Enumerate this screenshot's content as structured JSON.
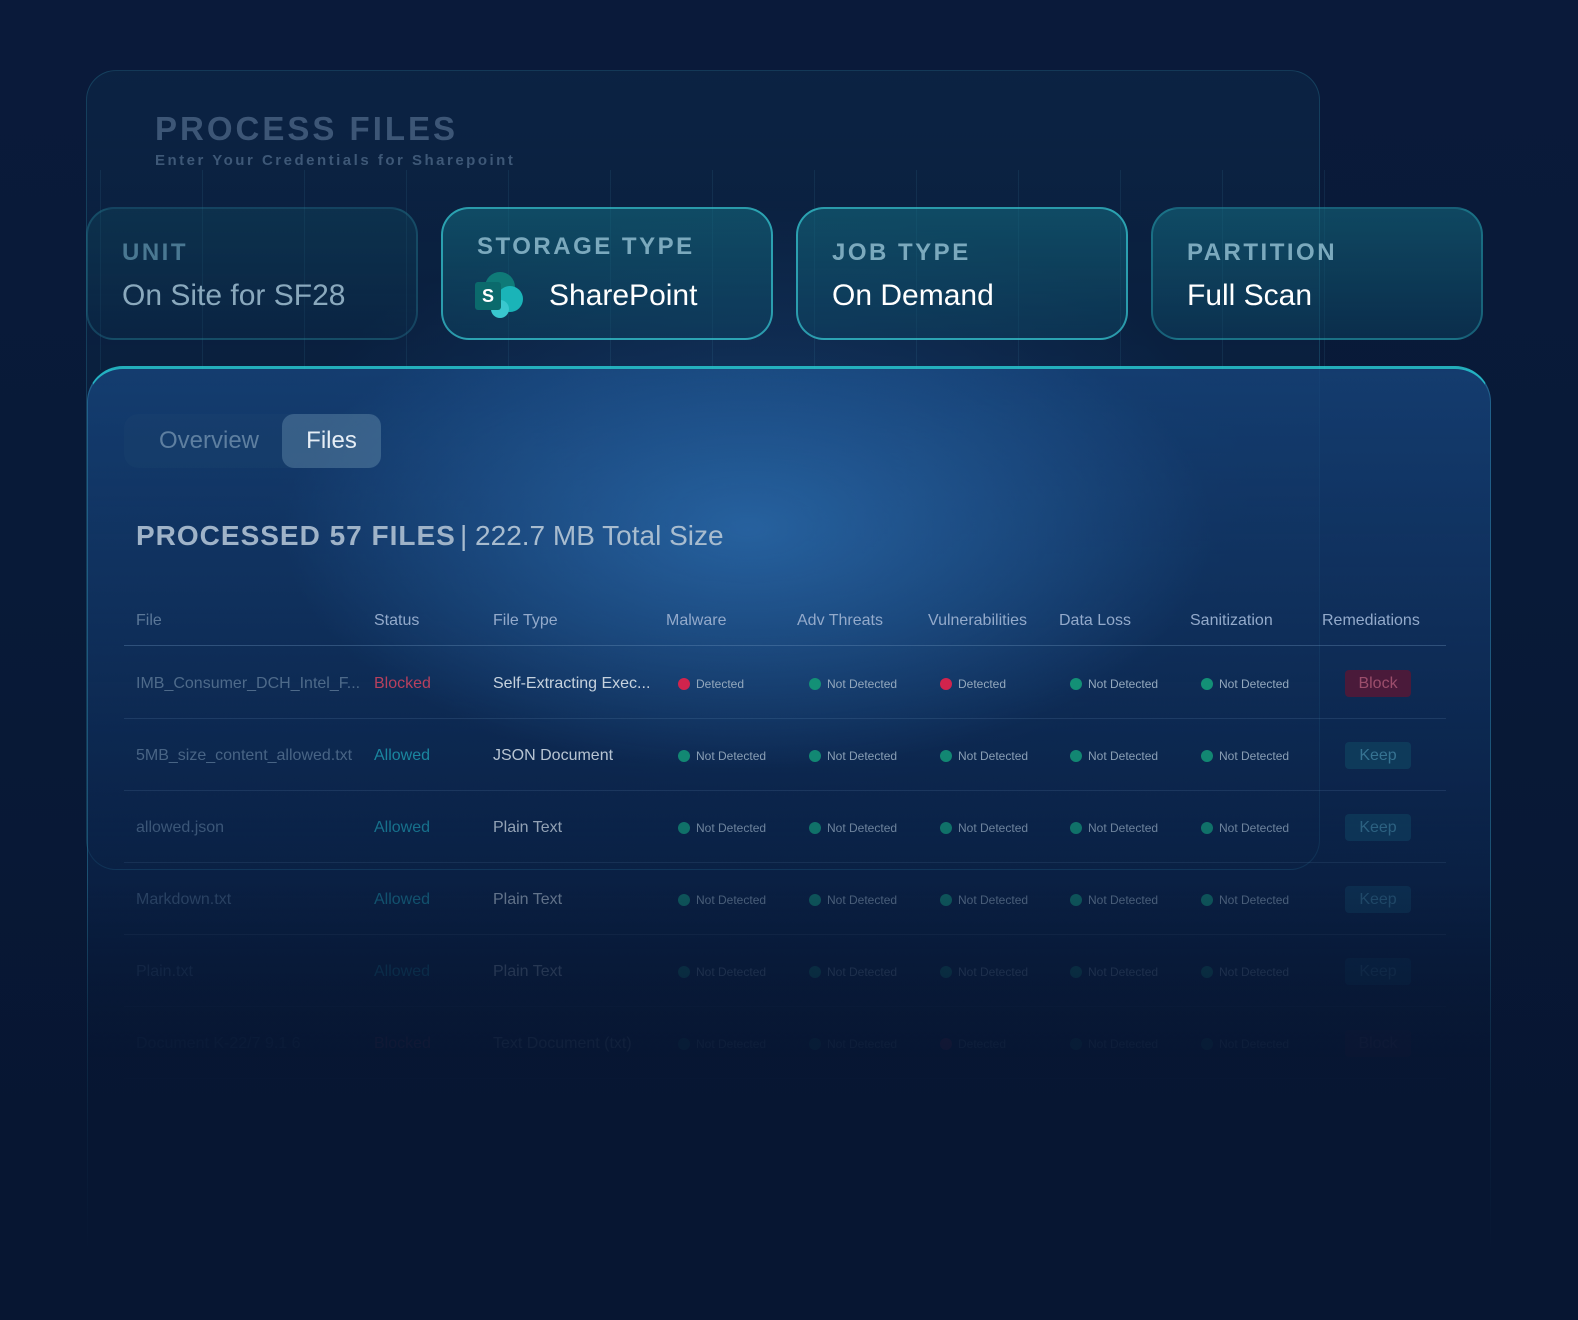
{
  "header": {
    "title": "PROCESS FILES",
    "subtitle": "Enter Your Credentials for Sharepoint"
  },
  "cards": {
    "unit": {
      "label": "UNIT",
      "value": "On Site for SF28"
    },
    "storage_type": {
      "label": "STORAGE TYPE",
      "value": "SharePoint",
      "icon": "sharepoint-icon",
      "icon_letter": "S"
    },
    "job_type": {
      "label": "JOB TYPE",
      "value": "On Demand"
    },
    "partition": {
      "label": "PARTITION",
      "value": "Full Scan"
    }
  },
  "tabs": [
    {
      "label": "Overview",
      "active": false
    },
    {
      "label": "Files",
      "active": true
    }
  ],
  "summary": {
    "processed": "PROCESSED 57 FILES",
    "total_size": "| 222.7 MB Total Size"
  },
  "table": {
    "columns": [
      "File",
      "Status",
      "File Type",
      "Malware",
      "Adv Threats",
      "Vulnerabilities",
      "Data Loss",
      "Sanitization",
      "Remediations"
    ],
    "rows": [
      {
        "file": "IMB_Consumer_DCH_Intel_F...",
        "status": "Blocked",
        "file_type": "Self-Extracting Exec...",
        "malware": "Detected",
        "adv_threats": "Not Detected",
        "vulnerabilities": "Detected",
        "data_loss": "Not Detected",
        "sanitization": "Not Detected",
        "remediation": "Block"
      },
      {
        "file": "5MB_size_content_allowed.txt",
        "status": "Allowed",
        "file_type": "JSON Document",
        "malware": "Not Detected",
        "adv_threats": "Not Detected",
        "vulnerabilities": "Not Detected",
        "data_loss": "Not Detected",
        "sanitization": "Not Detected",
        "remediation": "Keep"
      },
      {
        "file": "allowed.json",
        "status": "Allowed",
        "file_type": "Plain Text",
        "malware": "Not Detected",
        "adv_threats": "Not Detected",
        "vulnerabilities": "Not Detected",
        "data_loss": "Not Detected",
        "sanitization": "Not Detected",
        "remediation": "Keep"
      },
      {
        "file": "Markdown.txt",
        "status": "Allowed",
        "file_type": "Plain Text",
        "malware": "Not Detected",
        "adv_threats": "Not Detected",
        "vulnerabilities": "Not Detected",
        "data_loss": "Not Detected",
        "sanitization": "Not Detected",
        "remediation": "Keep"
      },
      {
        "file": "Plain.txt",
        "status": "Allowed",
        "file_type": "Plain Text",
        "malware": "Not Detected",
        "adv_threats": "Not Detected",
        "vulnerabilities": "Not Detected",
        "data_loss": "Not Detected",
        "sanitization": "Not Detected",
        "remediation": "Keep"
      },
      {
        "file": "Document K-22/7 9.1 6",
        "status": "Blocked",
        "file_type": "Text Document (txt)",
        "malware": "Not Detected",
        "adv_threats": "Not Detected",
        "vulnerabilities": "Detected",
        "data_loss": "Not Detected",
        "sanitization": "Not Detected",
        "remediation": "Block"
      }
    ]
  },
  "colors": {
    "detected": "#d1244d",
    "not_detected": "#139076",
    "accent": "#28c8d2",
    "blocked": "#b7405e",
    "allowed": "#1c8fa6"
  }
}
